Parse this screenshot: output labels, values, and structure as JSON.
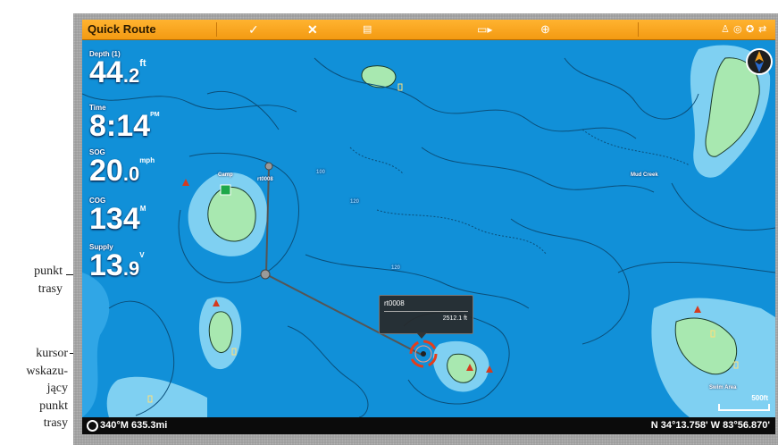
{
  "annotations": {
    "waypoint_label_line1": "punkt",
    "waypoint_label_line2": "trasy",
    "cursor_label_line1": "kursor",
    "cursor_label_line2": "wskazu-",
    "cursor_label_line3": "jący",
    "cursor_label_line4": "punkt",
    "cursor_label_line5": "trasy"
  },
  "topbar": {
    "title": "Quick Route",
    "accent_color": "#f7a21b"
  },
  "readouts": [
    {
      "label": "Depth (1)",
      "value": "44",
      "decimal": ".2",
      "unit": "ft"
    },
    {
      "label": "Time",
      "value": "8:14",
      "decimal": "",
      "unit": "PM"
    },
    {
      "label": "SOG",
      "value": "20",
      "decimal": ".0",
      "unit": "mph"
    },
    {
      "label": "COG",
      "value": "134",
      "decimal": "",
      "unit": "M"
    },
    {
      "label": "Supply",
      "value": "13",
      "decimal": ".9",
      "unit": "V"
    }
  ],
  "map": {
    "waypoint_label": "rt0008",
    "camp_label": "Camp",
    "mud_creek_label": "Mud Creek",
    "swim_area_label": "Swim Area",
    "scale_label": "500ft",
    "depth_labels": [
      "100",
      "120",
      "120"
    ],
    "water_color": "#1190d8"
  },
  "popup": {
    "name": "rt0008",
    "distance": "2512.1 ft"
  },
  "bottombar": {
    "heading_distance": "340°M 635.3mi",
    "position": "N 34°13.758' W 83°56.870'"
  }
}
